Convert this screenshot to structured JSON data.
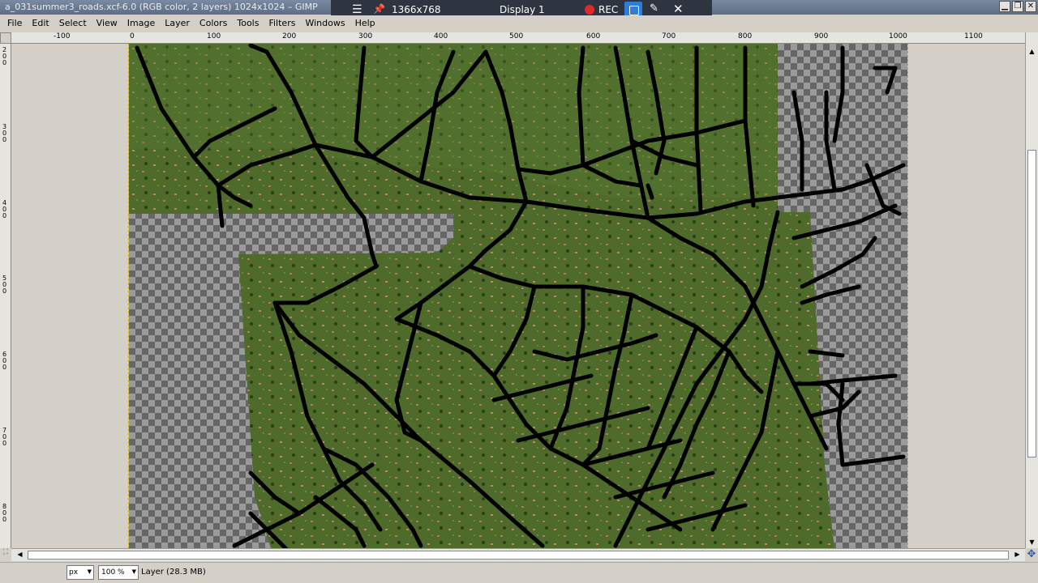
{
  "window": {
    "title": "a_031summer3_roads.xcf-6.0 (RGB color, 2 layers) 1024x1024 – GIMP",
    "controls": [
      "▁",
      "❐",
      "✕"
    ]
  },
  "recorder": {
    "resolution": "1366x768",
    "display": "Display 1",
    "rec_label": "REC",
    "menu_glyph": "☰",
    "pin_glyph": "📌",
    "pen_glyph": "✎",
    "close_glyph": "✕"
  },
  "menu": {
    "items": [
      "File",
      "Edit",
      "Select",
      "View",
      "Image",
      "Layer",
      "Colors",
      "Tools",
      "Filters",
      "Windows",
      "Help"
    ]
  },
  "ruler_h": {
    "labels": [
      "-100",
      "0",
      "100",
      "200",
      "300",
      "400",
      "500",
      "600",
      "700",
      "800",
      "900",
      "1000",
      "1100"
    ]
  },
  "ruler_v": {
    "labels": [
      "200",
      "300",
      "400",
      "500",
      "600",
      "700",
      "800"
    ]
  },
  "statusbar": {
    "unit": "px",
    "zoom": "100 %",
    "layer_info": "Layer (28.3 MB)"
  },
  "colors": {
    "grass": "#4e6b2c",
    "road": "#000000",
    "selection_border": "#c8b400",
    "rec_red": "#e02a2a"
  },
  "icons": {
    "navigate": "navigate-icon",
    "quick_mask": "quick-mask-icon"
  }
}
